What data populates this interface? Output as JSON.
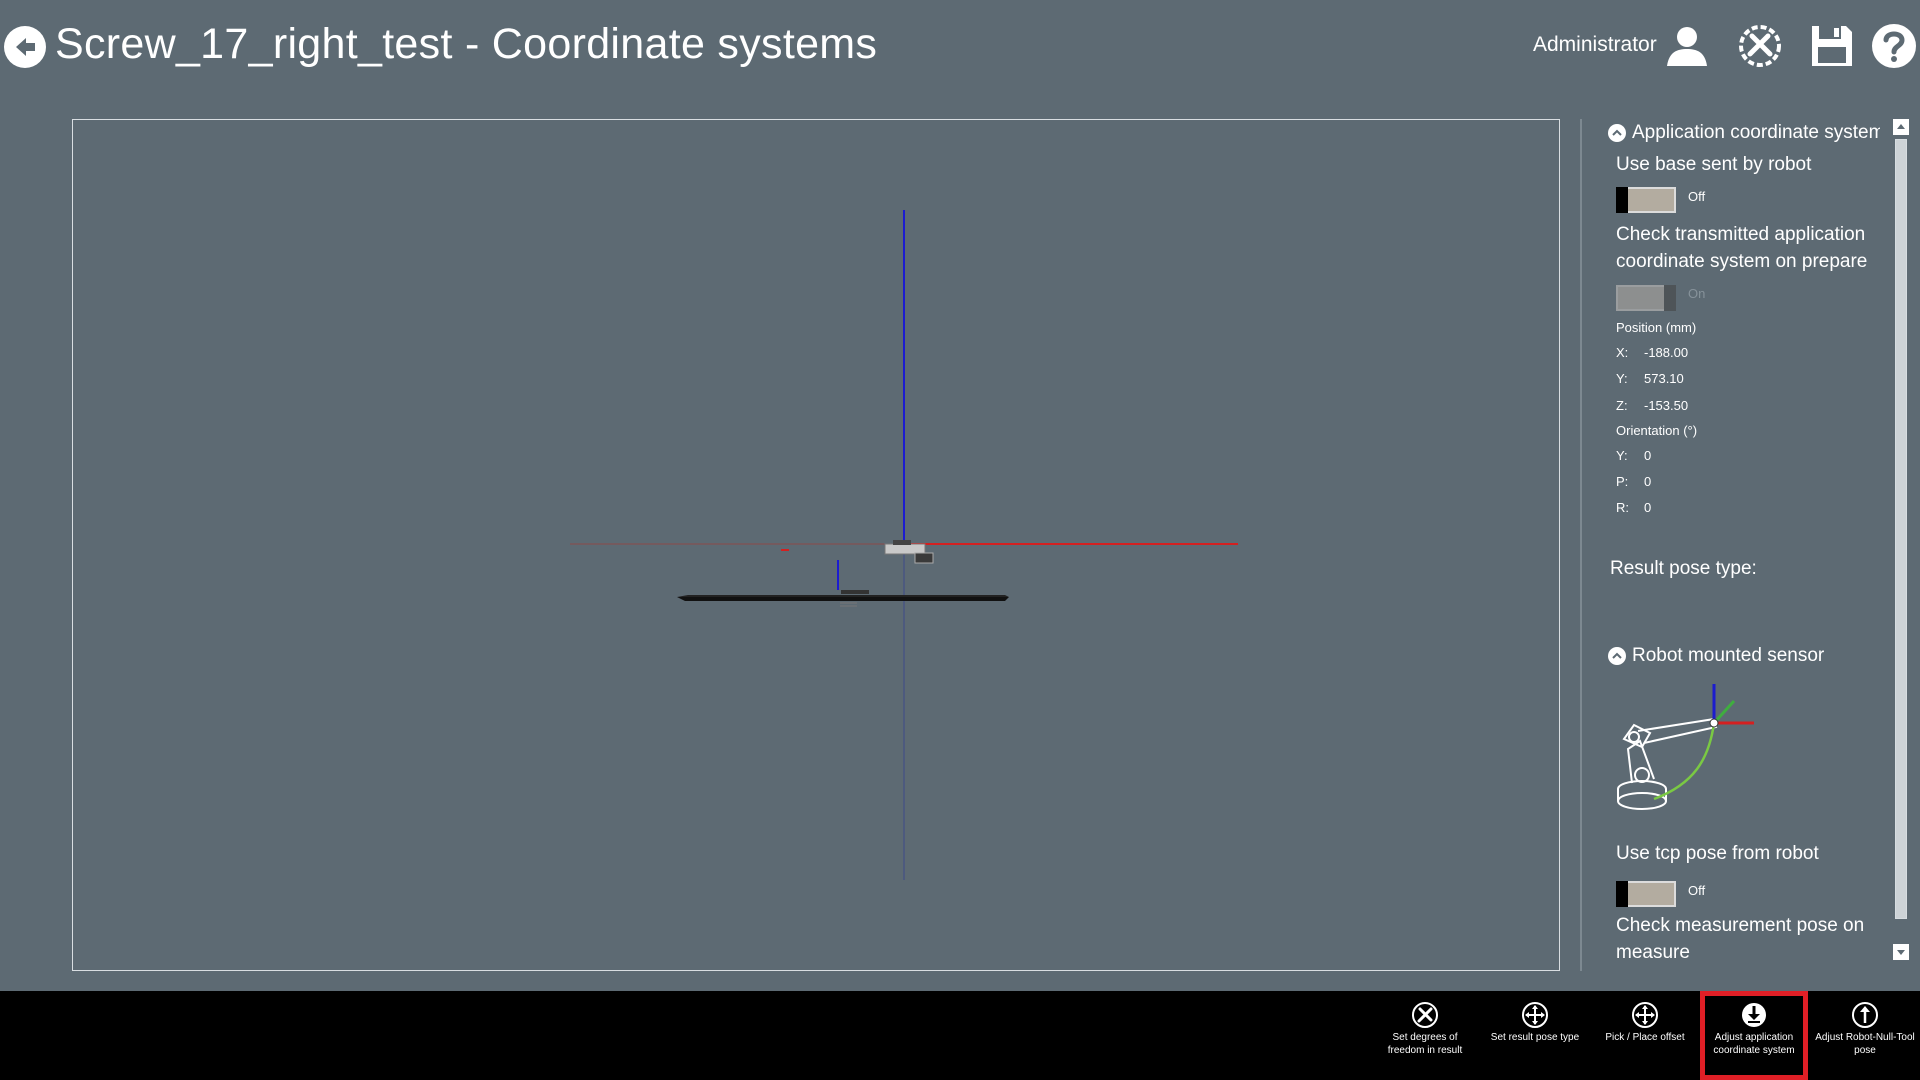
{
  "header": {
    "title": "Screw_17_right_test - Coordinate systems",
    "user": "Administrator"
  },
  "panel": {
    "app_cs": {
      "heading": "Application coordinate system",
      "use_base_label": "Use base sent by robot",
      "use_base_state": "Off",
      "check_transmitted_label": "Check transmitted application coordinate system on prepare",
      "check_transmitted_state": "On",
      "position_label": "Position (mm)",
      "position": [
        {
          "axis": "X:",
          "value": "-188.00"
        },
        {
          "axis": "Y:",
          "value": "573.10"
        },
        {
          "axis": "Z:",
          "value": "-153.50"
        }
      ],
      "orientation_label": "Orientation (°)",
      "orientation": [
        {
          "axis": "Y:",
          "value": "0"
        },
        {
          "axis": "P:",
          "value": "0"
        },
        {
          "axis": "R:",
          "value": "0"
        }
      ],
      "result_pose_label": "Result pose type:"
    },
    "sensor": {
      "heading": "Robot mounted sensor",
      "use_tcp_label": "Use tcp pose from robot",
      "use_tcp_state": "Off",
      "check_measurement_label": "Check measurement pose on measure"
    }
  },
  "toolbar": {
    "buttons": [
      {
        "label": "Set degrees of freedom in result",
        "icon": "wrench-icon"
      },
      {
        "label": "Set result pose type",
        "icon": "move-arrows-icon"
      },
      {
        "label": "Pick / Place offset",
        "icon": "move-arrows-icon"
      },
      {
        "label": "Adjust application coordinate system",
        "icon": "download-arrow-icon"
      },
      {
        "label": "Adjust Robot-Null-Tool pose",
        "icon": "up-arrow-icon"
      }
    ]
  },
  "colors": {
    "background": "#5d6a73",
    "toolbar": "#000000",
    "highlight": "#e01f26",
    "x_axis": "#d42020",
    "y_axis": "#3fae3f",
    "z_axis": "#1c1ccf"
  }
}
